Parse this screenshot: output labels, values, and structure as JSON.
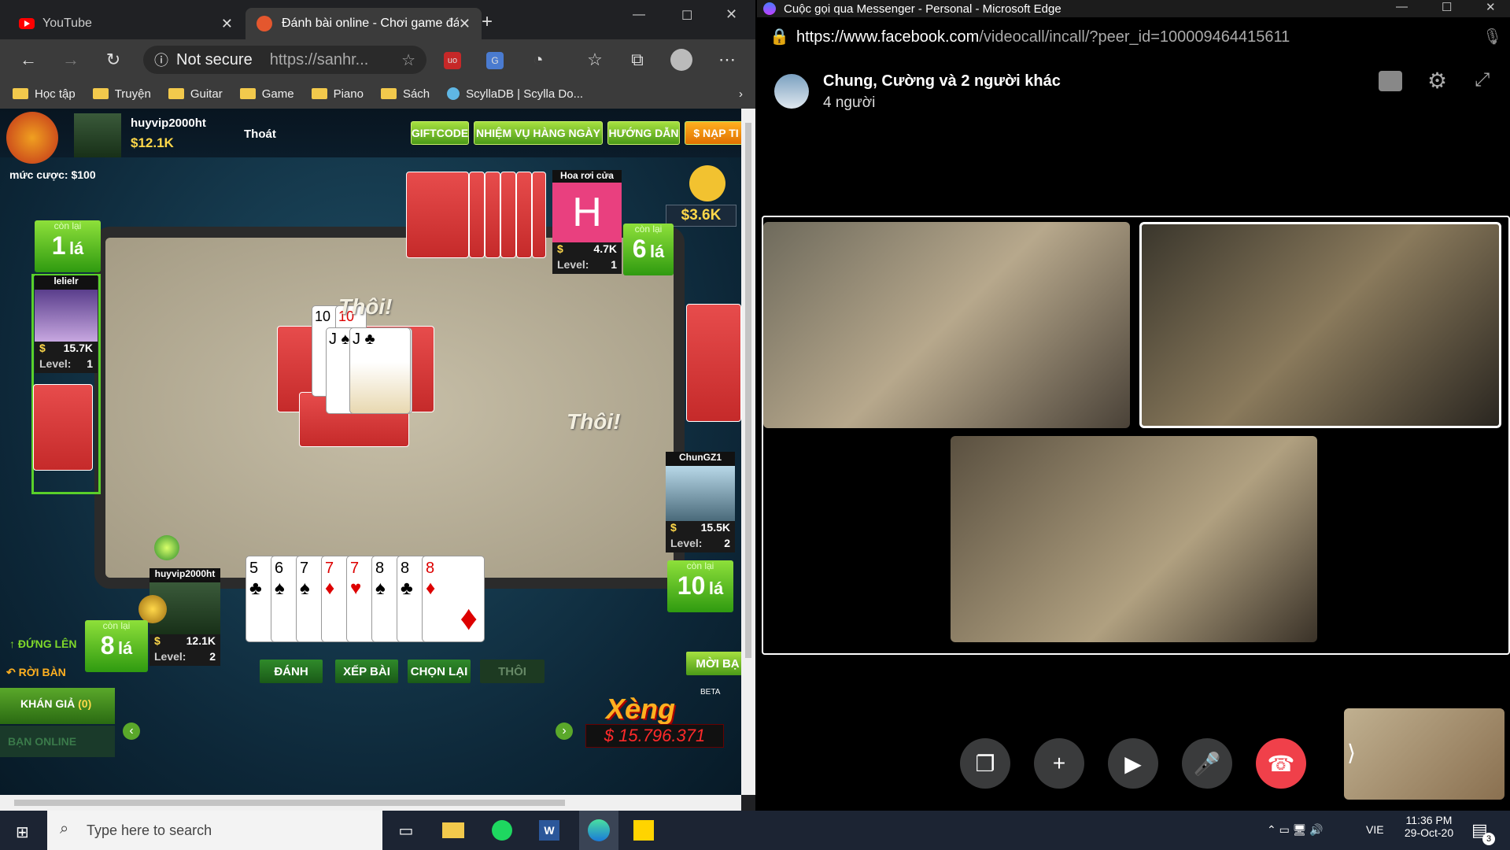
{
  "left_browser": {
    "tabs": [
      {
        "label": "YouTube"
      },
      {
        "label": "Đánh bài online - Chơi game đá"
      }
    ],
    "address": {
      "security": "Not secure",
      "url": "https://sanhr..."
    },
    "bookmarks": [
      "Học tập",
      "Truyện",
      "Guitar",
      "Game",
      "Piano",
      "Sách",
      "ScyllaDB | Scylla Do..."
    ]
  },
  "game": {
    "user": {
      "name": "huyvip2000ht",
      "money": "$12.1K",
      "logout": "Thoát"
    },
    "bet": "mức cược: $100",
    "top_buttons": [
      "GIFTCODE",
      "NHIỆM VỤ HÀNG NGÀY",
      "HƯỚNG DẪN",
      "$ NẠP TI"
    ],
    "jackpot_small": "$3.6K",
    "hoa_roi_cua": "Hoa rơi cửa",
    "player_h": {
      "letter": "H",
      "money": "4.7K",
      "level_label": "Level:",
      "level": "1",
      "con_lai": "còn lại",
      "count": "6",
      "la": "lá"
    },
    "player_left": {
      "name": "lelielr",
      "money": "15.7K",
      "level_label": "Level:",
      "level": "1",
      "con_lai": "còn lại",
      "count": "1",
      "la": "lá"
    },
    "player_right": {
      "name": "ChunGZ1",
      "money": "15.5K",
      "level_label": "Level:",
      "level": "2",
      "con_lai": "còn lại",
      "count": "10",
      "la": "lá"
    },
    "player_me": {
      "name": "huyvip2000ht",
      "money": "12.1K",
      "level_label": "Level:",
      "level": "2",
      "con_lai": "còn lại",
      "count": "8",
      "la": "lá"
    },
    "thoi_text": "Thôi!",
    "thoi_text2": "Thôi!",
    "played_cards": [
      "10",
      "10",
      "J",
      "J"
    ],
    "hand": [
      {
        "r": "5",
        "s": "♣"
      },
      {
        "r": "6",
        "s": "♠"
      },
      {
        "r": "7",
        "s": "♠"
      },
      {
        "r": "7",
        "s": "♦"
      },
      {
        "r": "7",
        "s": "♥"
      },
      {
        "r": "8",
        "s": "♠"
      },
      {
        "r": "8",
        "s": "♣"
      },
      {
        "r": "8",
        "s": "♦"
      }
    ],
    "actions": [
      "ĐÁNH",
      "XẾP BÀI",
      "CHỌN LẠI",
      "THÔI"
    ],
    "dung_len": "ĐỨNG LÊN",
    "roi_ban": "RỜI BÀN",
    "khan_gia": "KHÁN GIẢ",
    "khan_gia_count": "(0)",
    "ban_online": "BẠN ONLINE",
    "moi_ban": "MỜI BẠ",
    "xeng_label": "Xèng",
    "xeng_value": "$ 15.796.371",
    "beta": "BETA"
  },
  "messenger": {
    "window_title": "Cuộc gọi qua Messenger - Personal - Microsoft Edge",
    "url_host": "https://www.facebook.com",
    "url_path": "/videocall/incall/?peer_id=100009464415611",
    "group_name": "Chung, Cường và 2 người khác",
    "member_count": "4 người"
  },
  "taskbar": {
    "search_placeholder": "Type here to search",
    "lang": "VIE",
    "time": "11:36 PM",
    "date": "29-Oct-20",
    "notif_count": "3"
  }
}
